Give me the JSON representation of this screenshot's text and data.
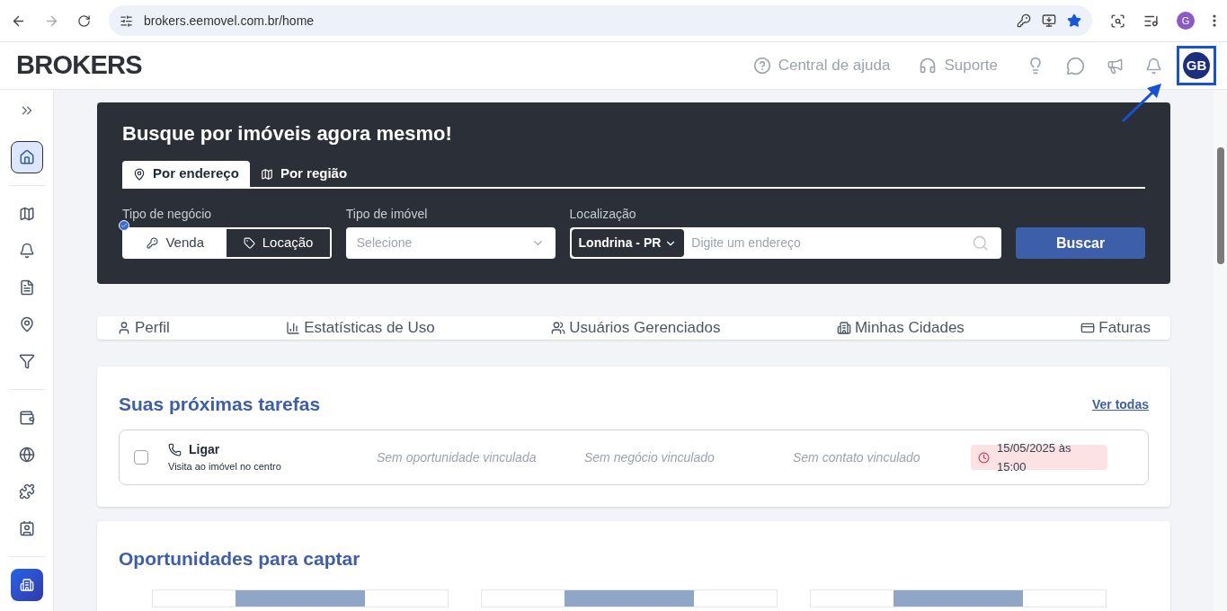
{
  "browser": {
    "url": "brokers.eemovel.com.br/home",
    "profile_initial": "G"
  },
  "header": {
    "logo": "BROKERS",
    "links": [
      {
        "kind": "help",
        "label": "Central de ajuda"
      },
      {
        "kind": "support",
        "label": "Suporte"
      }
    ],
    "avatar": "GB"
  },
  "sidebar": {
    "items": [
      {
        "kind": "home",
        "selected": true
      },
      {
        "kind": "map",
        "selected": false
      },
      {
        "kind": "bell",
        "selected": false
      },
      {
        "kind": "invoice",
        "selected": false
      },
      {
        "kind": "pin",
        "selected": false
      },
      {
        "kind": "filter",
        "selected": false
      },
      {
        "kind": "wallet",
        "selected": false
      },
      {
        "kind": "globe",
        "selected": false
      },
      {
        "kind": "puzzle",
        "selected": false
      },
      {
        "kind": "contact",
        "selected": false
      }
    ]
  },
  "search": {
    "title": "Busque por imóveis agora mesmo!",
    "tabs": [
      {
        "kind": "address",
        "label": "Por endereço",
        "selected": true
      },
      {
        "kind": "region",
        "label": "Por região",
        "selected": false
      }
    ],
    "business_label": "Tipo de negócio",
    "business_options": [
      {
        "kind": "sale",
        "label": "Venda",
        "selected": false
      },
      {
        "kind": "rent",
        "label": "Locação",
        "selected": true
      }
    ],
    "property_label": "Tipo de imóvel",
    "property_placeholder": "Selecione",
    "location_label": "Localização",
    "city": "Londrina - PR",
    "address_placeholder": "Digite um endereço",
    "button": "Buscar"
  },
  "nav": [
    {
      "kind": "user",
      "label": "Perfil"
    },
    {
      "kind": "stats",
      "label": "Estatísticas de Uso"
    },
    {
      "kind": "users",
      "label": "Usuários Gerenciados"
    },
    {
      "kind": "city",
      "label": "Minhas Cidades"
    },
    {
      "kind": "card",
      "label": "Faturas"
    }
  ],
  "tasks": {
    "title": "Suas próximas tarefas",
    "see_all": "Ver todas",
    "items": [
      {
        "checked": false,
        "type": "Ligar",
        "description": "Visita ao imóvel no centro",
        "opportunity": "Sem oportunidade vinculada",
        "business": "Sem negócio vinculado",
        "contact": "Sem contato vinculado",
        "due": "15/05/2025 às 15:00",
        "overdue": true
      }
    ]
  },
  "opportunities": {
    "title": "Oportunidades para captar"
  }
}
